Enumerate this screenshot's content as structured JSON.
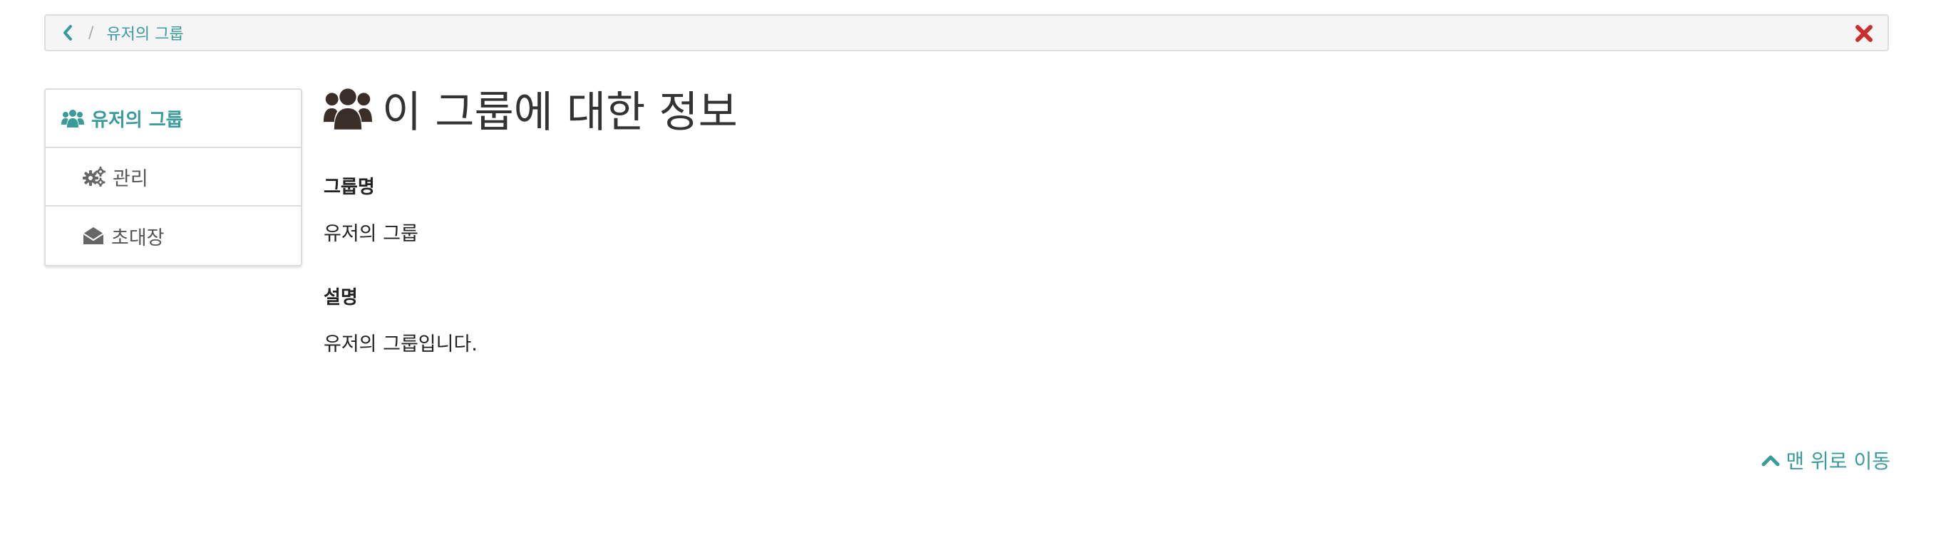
{
  "breadcrumb": {
    "separator": "/",
    "current": "유저의 그룹"
  },
  "sidebar": {
    "items": [
      {
        "label": "유저의 그룹",
        "icon": "users-icon"
      },
      {
        "label": "관리",
        "icon": "gears-icon"
      },
      {
        "label": "초대장",
        "icon": "envelope-open-icon"
      }
    ]
  },
  "main": {
    "title": "이 그룹에 대한 정보",
    "fields": [
      {
        "label": "그룹명",
        "value": "유저의 그룹"
      },
      {
        "label": "설명",
        "value": "유저의 그룹입니다."
      }
    ]
  },
  "footer": {
    "back_to_top": "맨 위로 이동"
  },
  "colors": {
    "accent": "#3a9b9b",
    "close": "#c9302c",
    "text": "#333333"
  }
}
